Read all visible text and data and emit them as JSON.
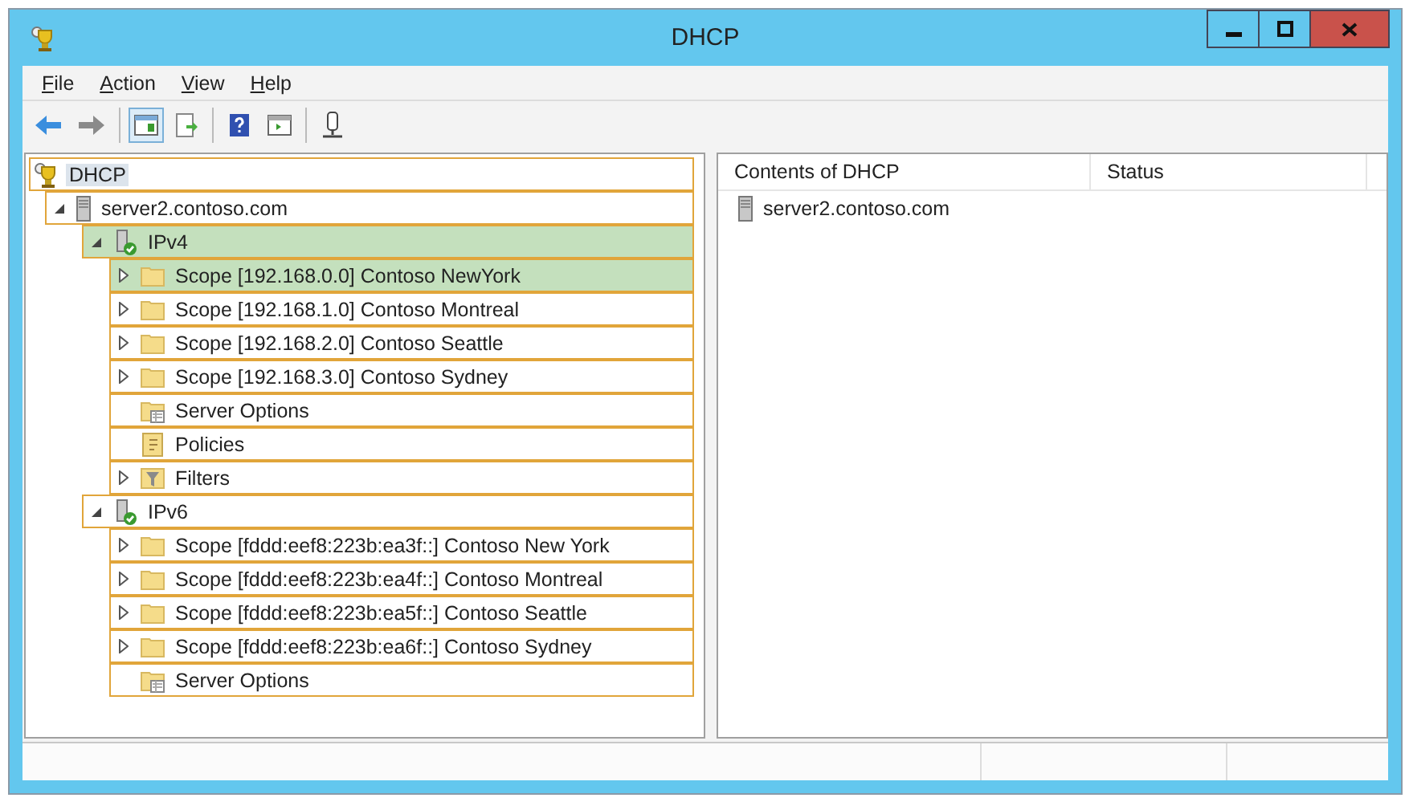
{
  "window": {
    "title": "DHCP"
  },
  "menu": [
    {
      "label": "File"
    },
    {
      "label": "Action"
    },
    {
      "label": "View"
    },
    {
      "label": "Help"
    }
  ],
  "toolbar": [
    {
      "kind": "back",
      "disabled": false
    },
    {
      "kind": "forward",
      "disabled": true
    },
    {
      "kind": "sep"
    },
    {
      "kind": "tree-toggle",
      "pressed": true
    },
    {
      "kind": "export",
      "pressed": false
    },
    {
      "kind": "sep"
    },
    {
      "kind": "help",
      "pressed": false
    },
    {
      "kind": "panel",
      "pressed": false
    },
    {
      "kind": "sep"
    },
    {
      "kind": "stand",
      "pressed": false
    }
  ],
  "tree": [
    {
      "label": "DHCP",
      "kind": "root",
      "selected": false,
      "children": [
        {
          "label": "server2.contoso.com",
          "kind": "server",
          "selected": false,
          "expanded": true,
          "children": [
            {
              "label": "IPv4",
              "kind": "protocol",
              "selected": true,
              "expanded": true,
              "children": [
                {
                  "label": "Scope [192.168.0.0] Contoso NewYork",
                  "kind": "folder",
                  "selected": true,
                  "expanded": false
                },
                {
                  "label": "Scope [192.168.1.0] Contoso Montreal",
                  "kind": "folder",
                  "selected": false,
                  "expanded": false
                },
                {
                  "label": "Scope [192.168.2.0] Contoso Seattle",
                  "kind": "folder",
                  "selected": false,
                  "expanded": false
                },
                {
                  "label": "Scope [192.168.3.0] Contoso Sydney",
                  "kind": "folder",
                  "selected": false,
                  "expanded": false
                },
                {
                  "label": "Server Options",
                  "kind": "options",
                  "selected": false
                },
                {
                  "label": "Policies",
                  "kind": "policies",
                  "selected": false
                },
                {
                  "label": "Filters",
                  "kind": "filters",
                  "selected": false,
                  "expanded": false
                }
              ]
            },
            {
              "label": "IPv6",
              "kind": "protocol",
              "selected": false,
              "expanded": true,
              "children": [
                {
                  "label": "Scope [fddd:eef8:223b:ea3f::] Contoso New York",
                  "kind": "folder",
                  "selected": false,
                  "expanded": false
                },
                {
                  "label": "Scope [fddd:eef8:223b:ea4f::] Contoso Montreal",
                  "kind": "folder",
                  "selected": false,
                  "expanded": false
                },
                {
                  "label": "Scope [fddd:eef8:223b:ea5f::] Contoso Seattle",
                  "kind": "folder",
                  "selected": false,
                  "expanded": false
                },
                {
                  "label": "Scope [fddd:eef8:223b:ea6f::] Contoso Sydney",
                  "kind": "folder",
                  "selected": false,
                  "expanded": false
                },
                {
                  "label": "Server Options",
                  "kind": "options",
                  "selected": false
                }
              ]
            }
          ]
        }
      ]
    }
  ],
  "contents": {
    "columns": [
      "Contents of DHCP",
      "Status"
    ],
    "rows": [
      {
        "kind": "server",
        "name": "server2.contoso.com"
      }
    ]
  }
}
